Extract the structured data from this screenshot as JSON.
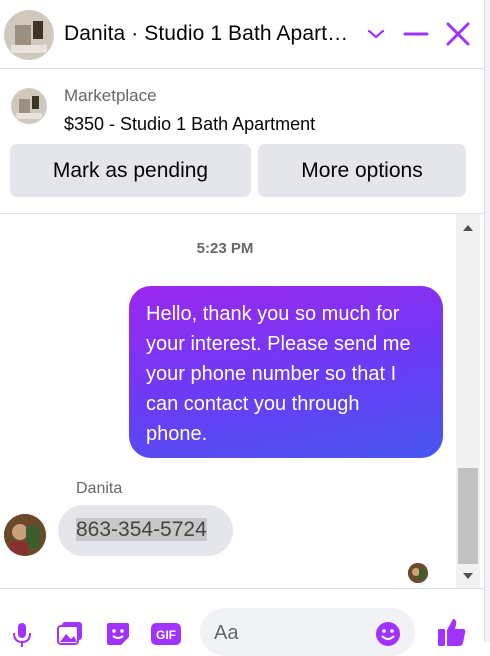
{
  "header": {
    "title": "Danita · Studio 1 Bath Apartment",
    "icons": [
      "chevron-down-icon",
      "minimize-icon",
      "close-icon"
    ],
    "accent_color": "#a033ff"
  },
  "listing": {
    "label": "Marketplace",
    "title": "$350 - Studio 1 Bath Apartment"
  },
  "actions": {
    "pending_label": "Mark as pending",
    "more_label": "More options"
  },
  "conversation": {
    "timestamp": "5:23 PM",
    "outgoing_message": "Hello, thank you so much for your interest. Please send me your phone number so that I can contact you through phone.",
    "sender_name": "Danita",
    "incoming_message": "863-354-5724"
  },
  "composer": {
    "placeholder": "Aa",
    "icons": [
      "microphone-icon",
      "photo-icon",
      "sticker-icon",
      "gif-icon",
      "emoji-icon",
      "thumbs-up-icon"
    ],
    "gif_label": "GIF"
  }
}
